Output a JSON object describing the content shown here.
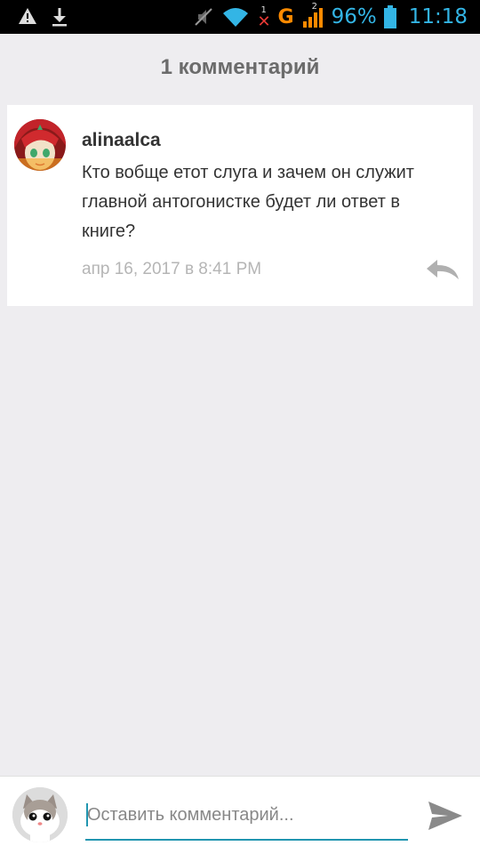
{
  "status_bar": {
    "battery_percent": "96%",
    "time": "11:18",
    "network_type": "G",
    "sim1_label": "1",
    "sim2_label": "2",
    "icons": [
      "warning-icon",
      "download-icon",
      "mute-icon",
      "wifi-icon",
      "no-signal-icon",
      "signal-icon",
      "battery-icon"
    ]
  },
  "header": {
    "title": "1 комментарий"
  },
  "comments": [
    {
      "username": "alinaalca",
      "text": "Кто вобще етот слуга и зачем он служит главной антогонистке будет ли ответ в книге?",
      "timestamp": "апр 16, 2017 в 8:41 PM"
    }
  ],
  "composer": {
    "placeholder": "Оставить комментарий...",
    "value": ""
  },
  "colors": {
    "accent": "#2196b0",
    "status_blue": "#33b5e5",
    "network_orange": "#ff8a00",
    "background": "#eeedf0"
  }
}
